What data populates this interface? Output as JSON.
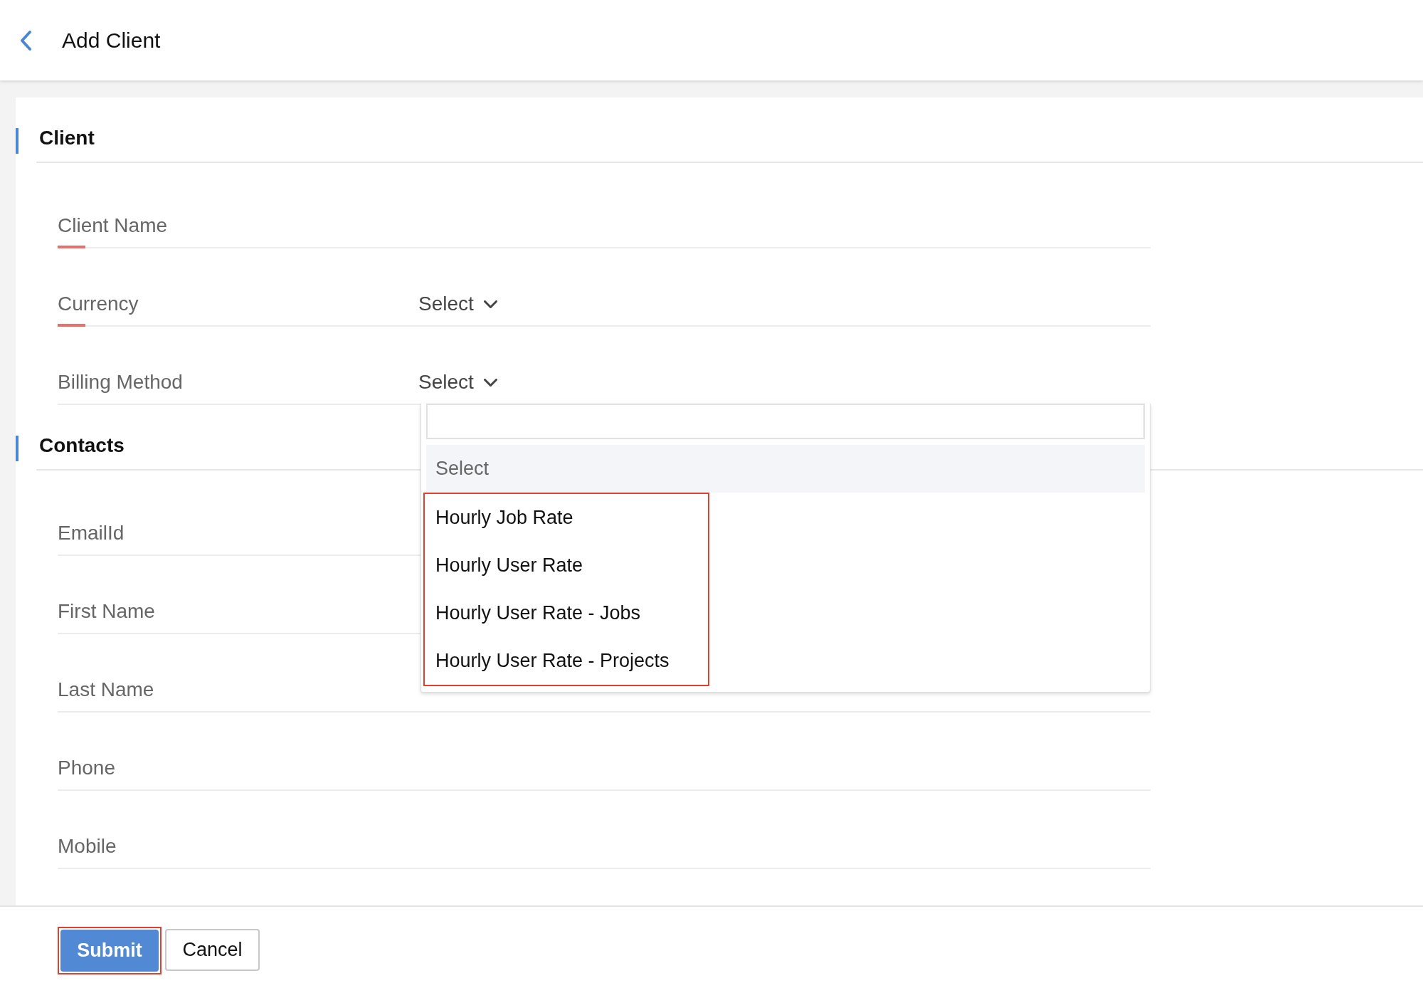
{
  "header": {
    "title": "Add Client"
  },
  "sections": [
    {
      "title": "Client",
      "fields": [
        {
          "label": "Client Name",
          "kind": "text",
          "required": true
        },
        {
          "label": "Currency",
          "kind": "select",
          "required": true,
          "value": "Select",
          "expanded": false
        },
        {
          "label": "Billing Method",
          "kind": "select",
          "required": false,
          "value": "Select",
          "expanded": true,
          "options": [
            {
              "label": "Select",
              "selected": true
            }
          ],
          "highlighted_options": [
            {
              "label": "Hourly Job Rate",
              "selected": false
            },
            {
              "label": "Hourly User Rate",
              "selected": false
            },
            {
              "label": "Hourly User Rate - Jobs",
              "selected": false
            },
            {
              "label": "Hourly User Rate - Projects",
              "selected": false
            }
          ]
        }
      ]
    },
    {
      "title": "Contacts",
      "fields": [
        {
          "label": "EmailId",
          "kind": "text",
          "required": false
        },
        {
          "label": "First Name",
          "kind": "text",
          "required": false
        },
        {
          "label": "Last Name",
          "kind": "text",
          "required": false
        },
        {
          "label": "Phone",
          "kind": "text",
          "required": false
        },
        {
          "label": "Mobile",
          "kind": "text",
          "required": false
        }
      ]
    }
  ],
  "footer": {
    "buttons": [
      {
        "label": "Submit",
        "kind": "primary",
        "annotated": true
      },
      {
        "label": "Cancel",
        "kind": "secondary",
        "annotated": false
      }
    ]
  }
}
